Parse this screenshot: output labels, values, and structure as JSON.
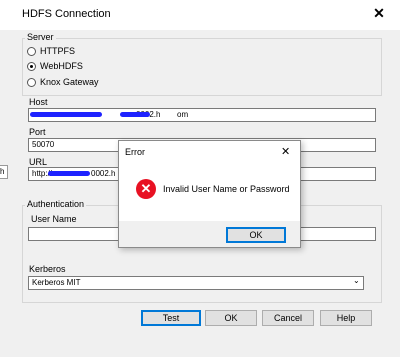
{
  "window": {
    "title": "HDFS Connection",
    "close_glyph": "✕"
  },
  "server": {
    "label": "Server",
    "options": [
      {
        "label": "HTTPFS",
        "selected": false
      },
      {
        "label": "WebHDFS",
        "selected": true
      },
      {
        "label": "Knox Gateway",
        "selected": false
      }
    ]
  },
  "host": {
    "label": "Host",
    "value_start": "",
    "value_mid": "0002.h",
    "value_end": "om"
  },
  "port": {
    "label": "Port",
    "value": "50070"
  },
  "url": {
    "label": "URL",
    "value_start": "http://",
    "value_end": "0002.h"
  },
  "left_edge_text": "h",
  "authentication": {
    "label": "Authentication",
    "username_label": "User Name",
    "username_value": ""
  },
  "kerberos": {
    "label": "Kerberos",
    "value": "Kerberos MIT",
    "arrow": "⌄"
  },
  "buttons": {
    "test": "Test",
    "ok": "OK",
    "cancel": "Cancel",
    "help": "Help"
  },
  "error_dialog": {
    "title": "Error",
    "close_glyph": "✕",
    "icon": "error-icon",
    "icon_glyph": "✕",
    "message": "Invalid User Name or Password",
    "ok": "OK"
  },
  "colors": {
    "error": "#e81123",
    "focus": "#0078d7",
    "redaction": "#1e22ff"
  }
}
